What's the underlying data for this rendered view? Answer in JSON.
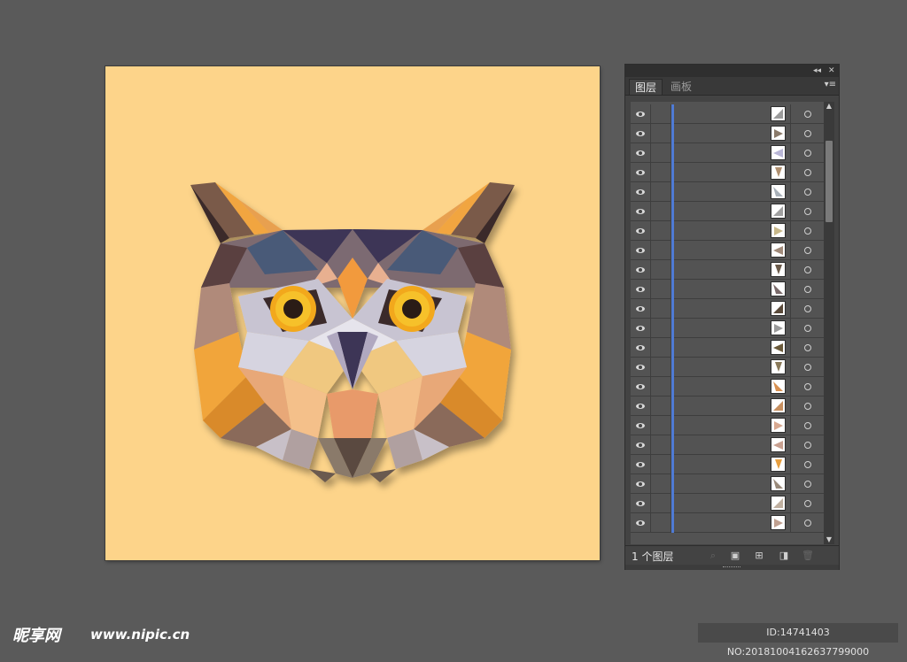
{
  "panel": {
    "collapse_icon": "◂◂",
    "close_icon": "✕",
    "tabs": [
      {
        "label": "图层",
        "active": true
      },
      {
        "label": "画板",
        "active": false
      }
    ],
    "menu_icon": "▾≡",
    "footer": {
      "layer_count": "1 个图层",
      "buttons": [
        "locate-object-icon",
        "make-clipping-mask-icon",
        "create-sublayer-icon",
        "new-layer-icon",
        "delete-icon"
      ]
    },
    "rows": [
      {
        "thumb_color": "#9b9b9b"
      },
      {
        "thumb_color": "#8a7a6a"
      },
      {
        "thumb_color": "#b9b6d6"
      },
      {
        "thumb_color": "#b09070"
      },
      {
        "thumb_color": "#a8b0b8"
      },
      {
        "thumb_color": "#a0a0a0"
      },
      {
        "thumb_color": "#c8b88a"
      },
      {
        "thumb_color": "#a08a7a"
      },
      {
        "thumb_color": "#6a5a4a"
      },
      {
        "thumb_color": "#7a6a6a"
      },
      {
        "thumb_color": "#5a4a3a"
      },
      {
        "thumb_color": "#9a9a9a"
      },
      {
        "thumb_color": "#6b5a3a"
      },
      {
        "thumb_color": "#8a7a5a"
      },
      {
        "thumb_color": "#d89050"
      },
      {
        "thumb_color": "#c89060"
      },
      {
        "thumb_color": "#d8a890"
      },
      {
        "thumb_color": "#c8a090"
      },
      {
        "thumb_color": "#e8a040"
      },
      {
        "thumb_color": "#9a8a7a"
      },
      {
        "thumb_color": "#c0b0a0"
      },
      {
        "thumb_color": "#c0a090"
      }
    ]
  },
  "artboard": {
    "background": "#fdd48a",
    "artwork": "low-poly owl head illustration"
  },
  "watermark": {
    "logo": "昵享网",
    "url": "www.nipic.cn",
    "id": "ID:14741403 NO:20181004162637799000"
  }
}
